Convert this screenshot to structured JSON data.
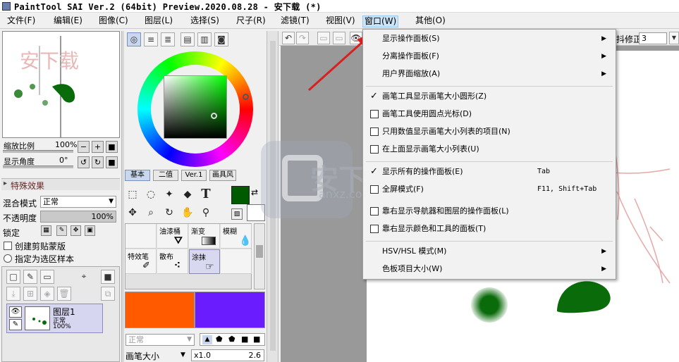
{
  "title_bar": {
    "text": "PaintTool SAI Ver.2 (64bit) Preview.2020.08.28 - 安下载 (*)"
  },
  "menubar": [
    {
      "label": "文件(F)"
    },
    {
      "label": "编辑(E)"
    },
    {
      "label": "图像(C)"
    },
    {
      "label": "图层(L)"
    },
    {
      "label": "选择(S)"
    },
    {
      "label": "尺子(R)"
    },
    {
      "label": "滤镜(T)"
    },
    {
      "label": "视图(V)"
    },
    {
      "label": "窗口(W)"
    },
    {
      "label": "其他(O)"
    }
  ],
  "navigator": {
    "watermark": "安下载",
    "zoom_label": "缩放比例",
    "zoom_value": "100%",
    "angle_label": "显示角度",
    "angle_value": "0°",
    "btn_zoom_out": "−",
    "btn_zoom_in": "+",
    "btn_zoom_reset": "■",
    "btn_rot_left": "↺",
    "btn_rot_right": "↻",
    "btn_rot_reset": "■"
  },
  "layer_panel": {
    "effects_label": "特殊效果",
    "blend_label": "混合模式",
    "blend_value": "正常",
    "opacity_label": "不透明度",
    "opacity_value": "100%",
    "lock_label": "锁定",
    "clip_label": "创建剪贴蒙版",
    "sample_label": "指定为选区样本",
    "layer": {
      "name": "图层1",
      "mode": "正常",
      "opacity": "100%"
    }
  },
  "color_panel": {
    "tabs": [
      {
        "label": "基本"
      },
      {
        "label": "二值"
      },
      {
        "label": "Ver.1"
      },
      {
        "label": "画具风"
      }
    ],
    "main_color": "#005a00",
    "tools": {
      "text_tool": "T"
    },
    "brush_cells": [
      {
        "label": ""
      },
      {
        "label": "油漆桶"
      },
      {
        "label": "渐变"
      },
      {
        "label": "模糊"
      },
      {
        "label": "特效笔"
      },
      {
        "label": "散布"
      },
      {
        "label": "涂抹"
      },
      {
        "label": ""
      }
    ],
    "swatch_left": "#ff5a00",
    "swatch_right": "#6a1cff",
    "mode_value": "正常",
    "brush_size_label": "画笔大小",
    "brush_size_mult": "x1.0",
    "brush_size_value": "2.6"
  },
  "canvas_toolbar": {
    "stabilizer_label": "抖修正",
    "stabilizer_value": "3"
  },
  "window_menu": {
    "items": [
      {
        "label": "显示操作面板(S)",
        "kind": "submenu"
      },
      {
        "label": "分离操作面板(F)",
        "kind": "submenu"
      },
      {
        "label": "用户界面缩放(A)",
        "kind": "submenu"
      },
      {
        "label": "画笔工具显示画笔大小圆形(Z)",
        "kind": "checked"
      },
      {
        "label": "画笔工具使用圆点光标(D)",
        "kind": "unchecked"
      },
      {
        "label": "只用数值显示画笔大小列表的项目(N)",
        "kind": "unchecked"
      },
      {
        "label": "在上面显示画笔大小列表(U)",
        "kind": "unchecked"
      },
      {
        "label": "显示所有的操作面板(E)",
        "kind": "checked",
        "shortcut": "Tab"
      },
      {
        "label": "全屏模式(F)",
        "kind": "unchecked",
        "shortcut": "F11, Shift+Tab"
      },
      {
        "label": "靠右显示导航器和图层的操作面板(L)",
        "kind": "unchecked"
      },
      {
        "label": "靠右显示颜色和工具的面板(T)",
        "kind": "unchecked"
      },
      {
        "label": "HSV/HSL 模式(M)",
        "kind": "submenu"
      },
      {
        "label": "色板项目大小(W)",
        "kind": "submenu"
      }
    ],
    "check_mark": "✓",
    "submenu_arrow": "▶"
  },
  "watermark": {
    "brand": "安下载",
    "domain": "anxz.com"
  },
  "colors": {
    "menu_highlight": "#cce4f7",
    "arrow": "#d92020",
    "stroke_green": "#0a6b0a"
  }
}
